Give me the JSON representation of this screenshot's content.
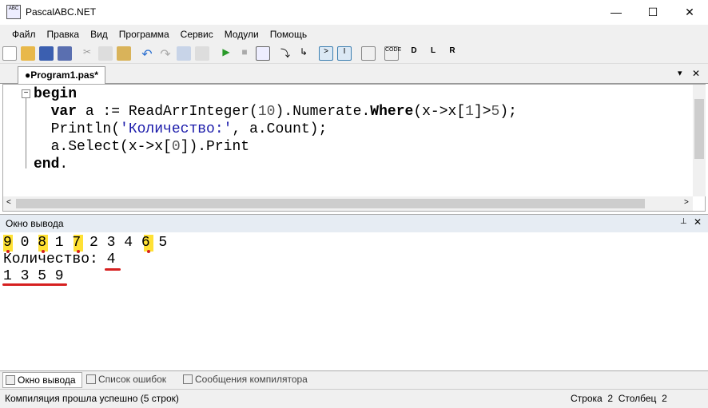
{
  "window": {
    "title": "PascalABC.NET",
    "app_icon_text": "ABC",
    "minimize": "—",
    "maximize": "☐",
    "close": "✕"
  },
  "menu": [
    "Файл",
    "Правка",
    "Вид",
    "Программа",
    "Сервис",
    "Модули",
    "Помощь"
  ],
  "toolbar": [
    "new-file",
    "open",
    "save",
    "save-all",
    "cut",
    "copy",
    "paste",
    "undo",
    "redo",
    "format",
    "tb",
    "run",
    "stop",
    "debug",
    "step-in",
    "step-over",
    "output-window",
    "error-list",
    "tb2",
    "code",
    "doc-d",
    "doc-l",
    "doc-r"
  ],
  "editor": {
    "tab": "●Program1.pas*",
    "tab_controls": {
      "dropdown": "▾",
      "close": "✕"
    },
    "lines": {
      "l1": {
        "kw": "begin"
      },
      "l2": {
        "a": "  ",
        "kw1": "var",
        "b": " a := ReadArrInteger(",
        "n1": "10",
        "c": ").Numerate.",
        "kw2": "Where",
        "d": "(x->x[",
        "n2": "1",
        "e": "]>",
        "n3": "5",
        "f": ");"
      },
      "l3": {
        "a": "  Println(",
        "s": "'Количество:'",
        "b": ", a.Count);"
      },
      "l4": {
        "a": "  a.Select(x->x[",
        "n": "0",
        "b": "]).Print"
      },
      "l5": {
        "kw": "end",
        "b": "."
      }
    }
  },
  "output": {
    "title": "Окно вывода",
    "pin": "📌",
    "close": "✕",
    "lines": [
      "9 0 8 1 7 2 3 4 6 5",
      "Количество: 4",
      "1 3 5 9"
    ]
  },
  "bottom_tabs": [
    "Окно вывода",
    "Список ошибок",
    "Сообщения компилятора"
  ],
  "status": {
    "message": "Компиляция прошла успешно (5 строк)",
    "position": "Строка  2  Столбец  2"
  },
  "colors": {
    "highlight": "#ffe135",
    "mark": "#d62020"
  }
}
